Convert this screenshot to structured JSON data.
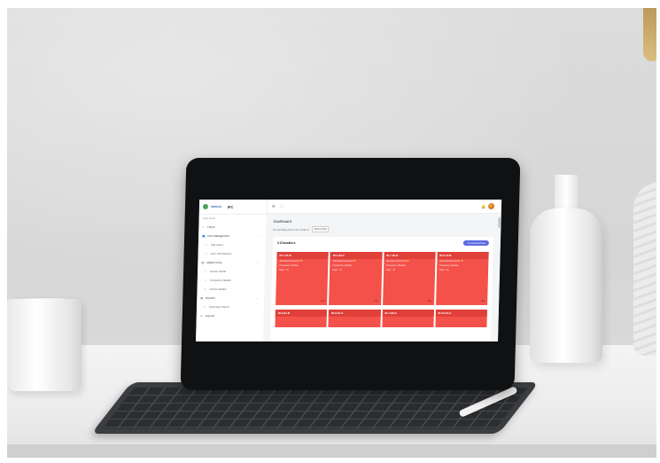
{
  "app": {
    "logo_text": "NIRMAN",
    "brand": "IFC",
    "menu_icon": "hamburger-icon",
    "fullscreen_icon": "expand-icon",
    "notification_icon": "bell-icon"
  },
  "sidebar": {
    "heading": "MAIN MENU",
    "items": [
      {
        "label": "Home",
        "icon": "home-icon",
        "sub": false,
        "chevron": false
      },
      {
        "label": "User Management",
        "icon": "users-icon",
        "sub": false,
        "chevron": true
      },
      {
        "label": "Add Users",
        "icon": "circle-icon",
        "sub": true,
        "chevron": false
      },
      {
        "label": "User Permissions",
        "icon": "circle-icon",
        "sub": true,
        "chevron": false
      },
      {
        "label": "Master Entry",
        "icon": "chart-icon",
        "sub": false,
        "chevron": true
      },
      {
        "label": "Device Model",
        "icon": "circle-icon",
        "sub": true,
        "chevron": false
      },
      {
        "label": "Frequency Master",
        "icon": "circle-icon",
        "sub": true,
        "chevron": false
      },
      {
        "label": "Device Master",
        "icon": "circle-icon",
        "sub": true,
        "chevron": false
      },
      {
        "label": "Reports",
        "icon": "report-icon",
        "sub": false,
        "chevron": true
      },
      {
        "label": "Summary Report",
        "icon": "circle-icon",
        "sub": true,
        "chevron": false
      },
      {
        "label": "Log out",
        "icon": "logout-icon",
        "sub": false,
        "chevron": false
      }
    ]
  },
  "main": {
    "title": "Dashboard",
    "filter_label": "Pin pending visit for the month of",
    "filter_value": "March 2024",
    "panel_title": "3 Chambers",
    "download_label": "Download Data",
    "cards": [
      {
        "id": "IR-7-21-B",
        "line1": "Allocated Instrument",
        "line2": "Frequency: Weekly",
        "line3": "Days : 22",
        "action": "Go"
      },
      {
        "id": "IR-4-22-C",
        "line1": "Allocated Instrument",
        "line2": "Frequency: Monthly",
        "line3": "Days : 14",
        "action": "Go"
      },
      {
        "id": "IN-7-25-G",
        "line1": "Allocated Instrument",
        "line2": "Frequency: Monthly",
        "line3": "Days : 31",
        "action": "Go"
      },
      {
        "id": "IR-9-12-B",
        "line1": "Allocated Instrument",
        "line2": "Frequency: Weekly",
        "line3": "Days : 26",
        "action": "Go"
      }
    ],
    "cards_row2": [
      {
        "id": "IR-2-21-B"
      },
      {
        "id": "IR-9-21-C"
      },
      {
        "id": "IN-7-25-N"
      },
      {
        "id": "IR-10-21-C"
      }
    ]
  },
  "colors": {
    "card_red": "#f4514a",
    "card_head_red": "#e0403a",
    "accent_blue": "#5b6be0"
  }
}
